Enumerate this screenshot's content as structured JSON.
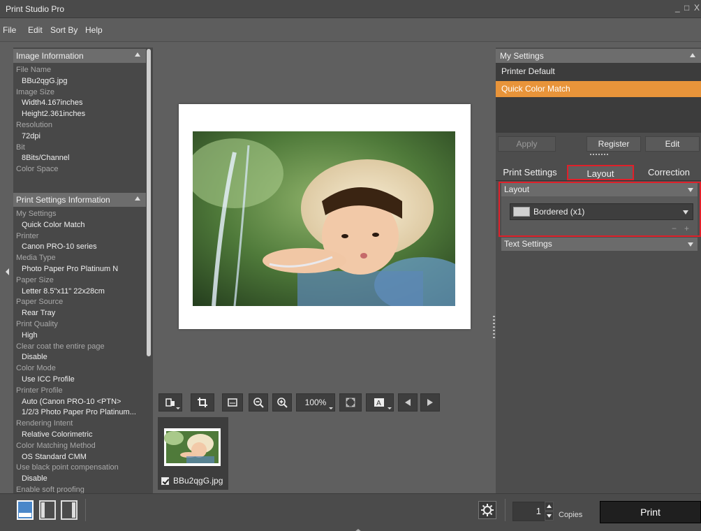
{
  "window": {
    "title": "Print Studio Pro",
    "controls": "_ □ X"
  },
  "menu": [
    "File",
    "Edit",
    "Sort By",
    "Help"
  ],
  "image_info": {
    "header": "Image Information",
    "lines": [
      {
        "type": "lbl",
        "text": "File Name"
      },
      {
        "type": "val",
        "text": "BBu2qgG.jpg"
      },
      {
        "type": "lbl",
        "text": "Image Size"
      },
      {
        "type": "val",
        "text": "Width4.167inches"
      },
      {
        "type": "val",
        "text": "Height2.361inches"
      },
      {
        "type": "lbl",
        "text": "Resolution"
      },
      {
        "type": "val",
        "text": "72dpi"
      },
      {
        "type": "lbl",
        "text": "Bit"
      },
      {
        "type": "val",
        "text": "8Bits/Channel"
      },
      {
        "type": "lbl",
        "text": "Color Space"
      }
    ]
  },
  "print_info": {
    "header": "Print Settings Information",
    "lines": [
      {
        "type": "lbl",
        "text": "My Settings"
      },
      {
        "type": "val",
        "text": "Quick Color Match"
      },
      {
        "type": "lbl",
        "text": "Printer"
      },
      {
        "type": "val",
        "text": "Canon PRO-10 series"
      },
      {
        "type": "lbl",
        "text": "Media Type"
      },
      {
        "type": "val",
        "text": "Photo Paper Pro Platinum N"
      },
      {
        "type": "lbl",
        "text": "Paper Size"
      },
      {
        "type": "val",
        "text": "Letter 8.5\"x11\" 22x28cm"
      },
      {
        "type": "lbl",
        "text": "Paper Source"
      },
      {
        "type": "val",
        "text": "Rear Tray"
      },
      {
        "type": "lbl",
        "text": "Print Quality"
      },
      {
        "type": "val",
        "text": "High"
      },
      {
        "type": "lbl",
        "text": "Clear coat the entire page"
      },
      {
        "type": "val",
        "text": "Disable"
      },
      {
        "type": "lbl",
        "text": "Color Mode"
      },
      {
        "type": "val",
        "text": "Use ICC Profile"
      },
      {
        "type": "lbl",
        "text": "Printer Profile"
      },
      {
        "type": "val",
        "text": "Auto (Canon PRO-10 <PTN>"
      },
      {
        "type": "val",
        "text": "1/2/3 Photo Paper Pro Platinum..."
      },
      {
        "type": "lbl",
        "text": "Rendering Intent"
      },
      {
        "type": "val",
        "text": "Relative Colorimetric"
      },
      {
        "type": "lbl",
        "text": "Color Matching Method"
      },
      {
        "type": "val",
        "text": "OS Standard CMM"
      },
      {
        "type": "lbl",
        "text": "Use black point compensation"
      },
      {
        "type": "val",
        "text": "Disable"
      },
      {
        "type": "lbl",
        "text": "Enable soft proofing"
      }
    ]
  },
  "toolbar": {
    "zoom": "100%"
  },
  "thumbnail": {
    "filename": "BBu2qgG.jpg",
    "checked": true
  },
  "my_settings": {
    "header": "My Settings",
    "items": [
      "Printer Default",
      "Quick Color Match"
    ],
    "selected": "Quick Color Match",
    "apply": "Apply",
    "register": "Register",
    "edit": "Edit"
  },
  "tabs": {
    "print_settings": "Print Settings",
    "layout": "Layout",
    "correction": "Correction",
    "active": "Layout"
  },
  "layout_section": {
    "header": "Layout",
    "select_value": "Bordered (x1)",
    "minus": "−",
    "plus": "+"
  },
  "text_settings": {
    "header": "Text Settings"
  },
  "bottom": {
    "copies_value": "1",
    "copies_label": "Copies",
    "print_label": "Print"
  },
  "colors": {
    "accent": "#e8943a",
    "highlight_red": "#e0202a",
    "view_active": "#4a87c9"
  }
}
